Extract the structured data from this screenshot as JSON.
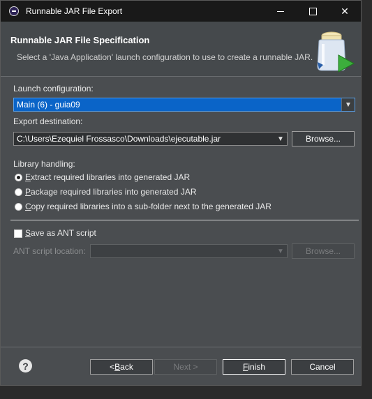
{
  "window": {
    "title": "Runnable JAR File Export",
    "controls": {
      "minimize": "minimize",
      "maximize": "maximize",
      "close": "✕"
    }
  },
  "banner": {
    "title": "Runnable JAR File Specification",
    "description": "Select a 'Java Application' launch configuration to use to create a runnable JAR.",
    "icon": "jar-export-icon"
  },
  "launch": {
    "label": "Launch configuration:",
    "value": "Main (6) - guia09"
  },
  "export": {
    "label": "Export destination:",
    "value": "C:\\Users\\Ezequiel Frossasco\\Downloads\\ejecutable.jar",
    "browse": "Browse..."
  },
  "library": {
    "label": "Library handling:",
    "options": [
      {
        "mnemonic": "E",
        "rest": "xtract required libraries into generated JAR",
        "checked": true
      },
      {
        "mnemonic": "P",
        "rest": "ackage required libraries into generated JAR",
        "checked": false
      },
      {
        "mnemonic": "C",
        "rest": "opy required libraries into a sub-folder next to the generated JAR",
        "checked": false
      }
    ]
  },
  "ant": {
    "checkbox_mnemonic": "S",
    "checkbox_rest": "ave as ANT script",
    "checked": false,
    "location_label": "ANT script location:",
    "location_value": "",
    "browse": "Browse..."
  },
  "footer": {
    "help": "?",
    "back": {
      "prefix": "< ",
      "mnemonic": "B",
      "rest": "ack"
    },
    "next": "Next >",
    "finish": {
      "mnemonic": "F",
      "rest": "inish"
    },
    "cancel": "Cancel"
  },
  "colors": {
    "selection": "#0a64c8",
    "background": "#4a4d50",
    "titlebar": "#191919"
  }
}
